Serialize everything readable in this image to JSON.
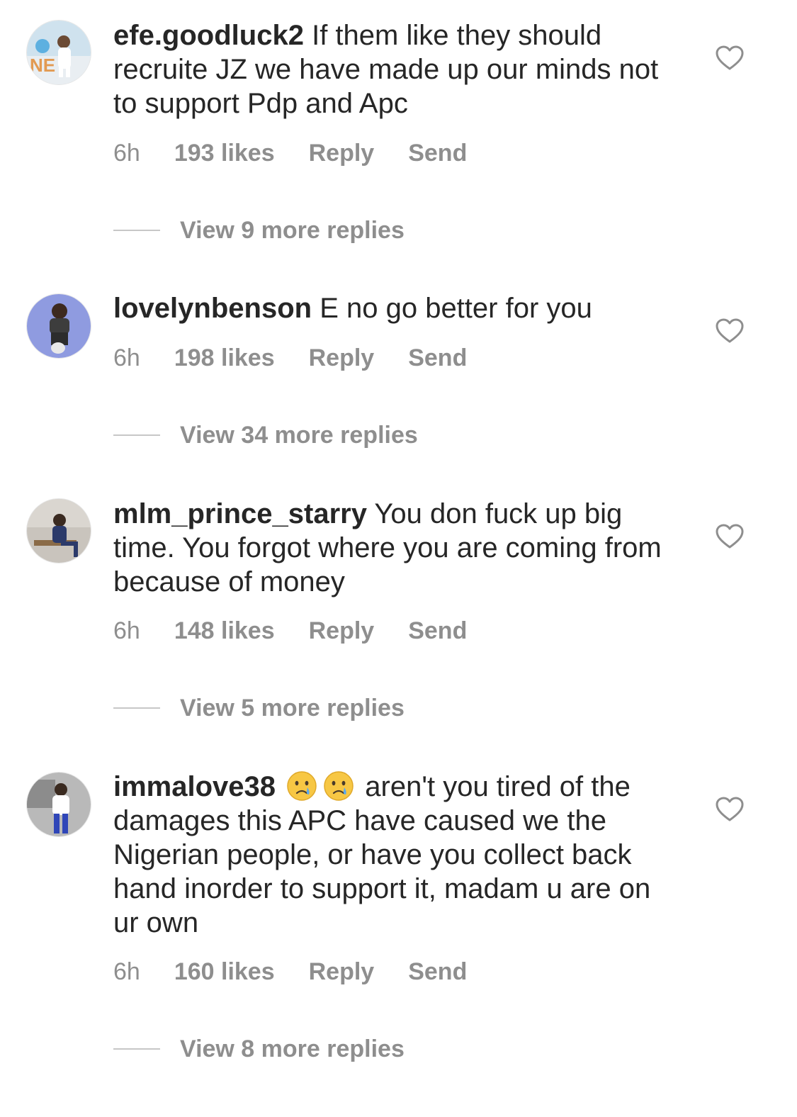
{
  "comments": [
    {
      "username": "efe.goodluck2",
      "text": "If them like they should recruite JZ we have made up our minds not to support Pdp and Apc",
      "time": "6h",
      "likes": "193 likes",
      "reply": "Reply",
      "send": "Send",
      "view_replies": "View 9 more replies",
      "avatar_colors": [
        "#cfe2ee",
        "#ffffff",
        "#e29a52"
      ]
    },
    {
      "username": "lovelynbenson",
      "text": "E no go better for you",
      "time": "6h",
      "likes": "198 likes",
      "reply": "Reply",
      "send": "Send",
      "view_replies": "View 34 more replies",
      "avatar_colors": [
        "#8f9be0",
        "#3d3d3d",
        "#6f7fd6"
      ]
    },
    {
      "username": "mlm_prince_starry",
      "text": "You don fuck up big time. You forgot where you are coming from because of money",
      "time": "6h",
      "likes": "148 likes",
      "reply": "Reply",
      "send": "Send",
      "view_replies": "View 5 more replies",
      "avatar_colors": [
        "#c9c4bd",
        "#2b3a6a",
        "#8a6b48"
      ]
    },
    {
      "username": "immalove38",
      "emoji": "😢😢",
      "text": "aren't you tired of the damages this APC have caused we the Nigerian people, or have you collect back hand inorder to support it, madam u are on ur own",
      "time": "6h",
      "likes": "160 likes",
      "reply": "Reply",
      "send": "Send",
      "view_replies": "View 8 more replies",
      "avatar_colors": [
        "#b9b9b9",
        "#ffffff",
        "#2f46b8"
      ]
    }
  ]
}
